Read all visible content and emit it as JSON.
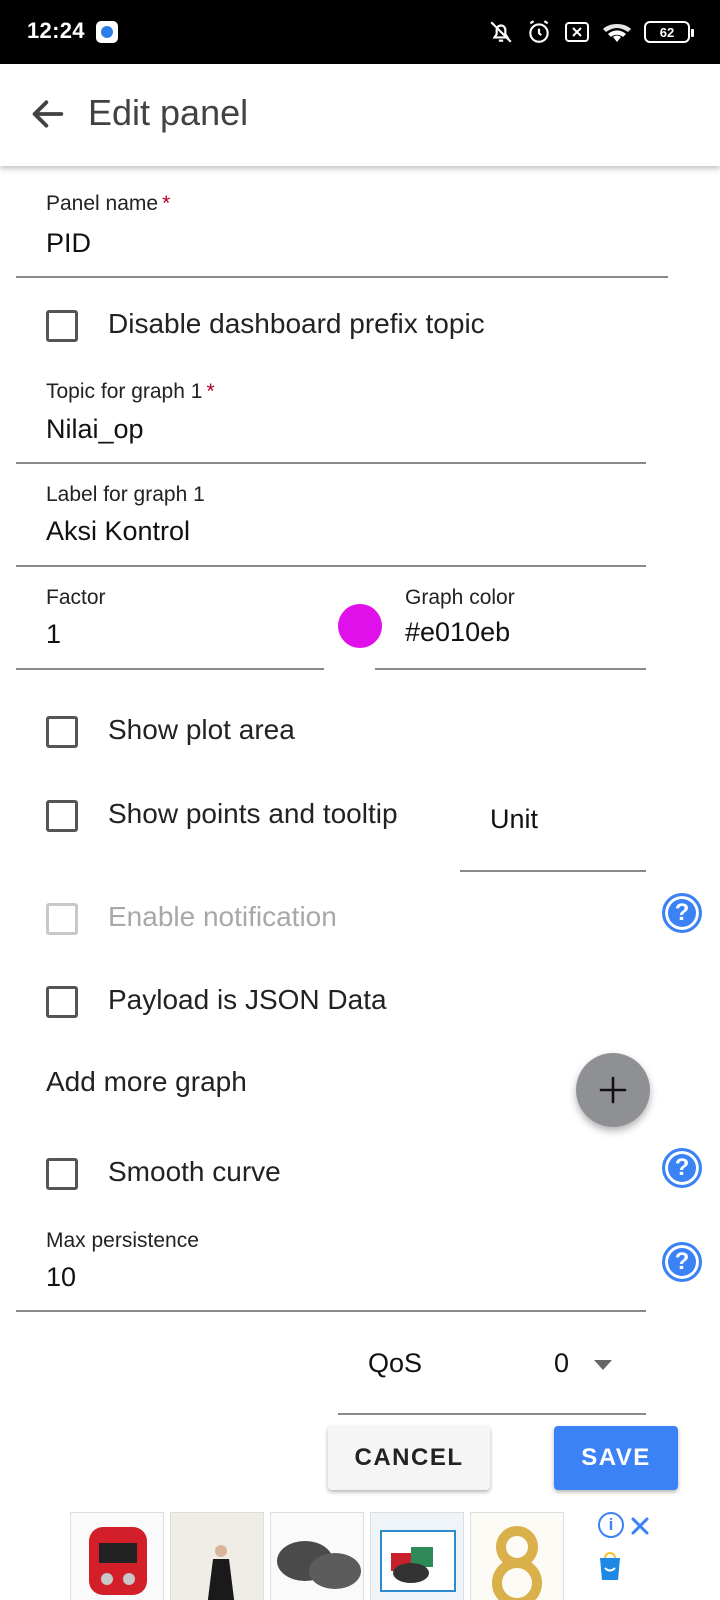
{
  "status_bar": {
    "time": "12:24",
    "battery": "62",
    "icons": [
      "app-notification-icon",
      "mute-icon",
      "alarm-icon",
      "sim-off-icon",
      "wifi-icon",
      "battery-icon"
    ]
  },
  "app_bar": {
    "title": "Edit panel"
  },
  "form": {
    "panel_name": {
      "label": "Panel name",
      "required": "*",
      "value": "PID"
    },
    "disable_prefix": {
      "label": "Disable dashboard prefix topic",
      "checked": false
    },
    "topic_graph1": {
      "label": "Topic for graph 1",
      "required": "*",
      "value": "Nilai_op"
    },
    "label_graph1": {
      "label": "Label for graph 1",
      "value": "Aksi Kontrol"
    },
    "factor": {
      "label": "Factor",
      "value": "1"
    },
    "graph_color": {
      "label": "Graph color",
      "value": "#e010eb",
      "swatch": "#e010eb"
    },
    "show_plot_area": {
      "label": "Show plot area",
      "checked": false
    },
    "show_points": {
      "label": "Show points and tooltip",
      "checked": false
    },
    "unit": {
      "placeholder": "Unit"
    },
    "enable_notification": {
      "label": "Enable notification",
      "checked": false,
      "disabled": true
    },
    "payload_json": {
      "label": "Payload is JSON Data",
      "checked": false
    },
    "add_more_graph": {
      "label": "Add more graph"
    },
    "smooth_curve": {
      "label": "Smooth curve",
      "checked": false
    },
    "max_persistence": {
      "label": "Max persistence",
      "value": "10"
    },
    "qos": {
      "label": "QoS",
      "value": "0"
    }
  },
  "actions": {
    "cancel_label": "CANCEL",
    "save_label": "SAVE"
  },
  "colors": {
    "accent": "#3b82f6",
    "required": "#b00020",
    "fab": "#8e9094"
  }
}
